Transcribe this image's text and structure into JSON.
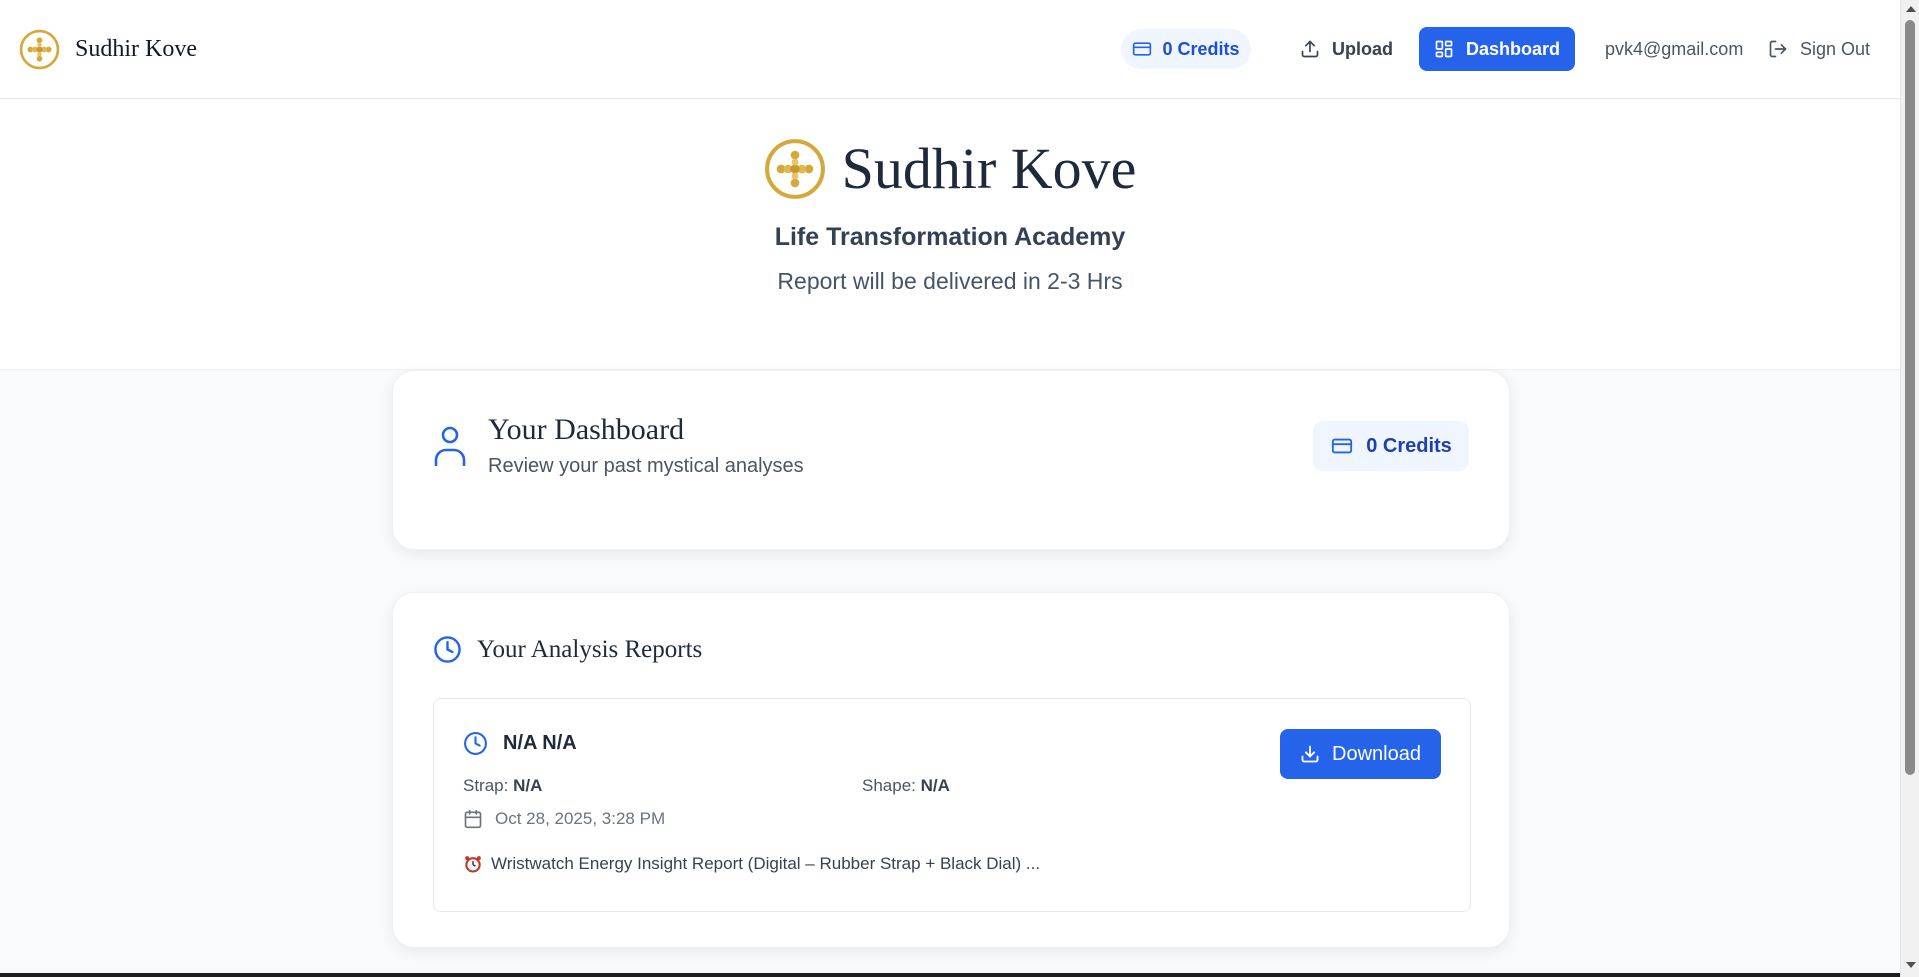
{
  "colors": {
    "primary": "#2563eb",
    "gold": "#d4a83a",
    "pill_bg": "#eff6ff",
    "text_dark": "#1e293b"
  },
  "nav": {
    "brand_name": "Sudhir Kove",
    "logo_icon": "golden-flower-logo-icon",
    "credits_label": "0 Credits",
    "upload_label": "Upload",
    "dashboard_label": "Dashboard",
    "email": "pvk4@gmail.com",
    "signout_label": "Sign Out"
  },
  "hero": {
    "title": "Sudhir Kove",
    "subtitle": "Life Transformation Academy",
    "note": "Report will be delivered in 2-3 Hrs"
  },
  "dashboard": {
    "title": "Your Dashboard",
    "subtitle": "Review your past mystical analyses",
    "credits_label": "0 Credits"
  },
  "reports": {
    "title": "Your Analysis Reports",
    "items": [
      {
        "title": "N/A N/A",
        "strap_label": "Strap:",
        "strap_value": "N/A",
        "shape_label": "Shape:",
        "shape_value": "N/A",
        "date": "Oct 28, 2025, 3:28 PM",
        "description": "Wristwatch Energy Insight Report (Digital – Rubber Strap + Black Dial) ...",
        "download_label": "Download"
      }
    ]
  }
}
